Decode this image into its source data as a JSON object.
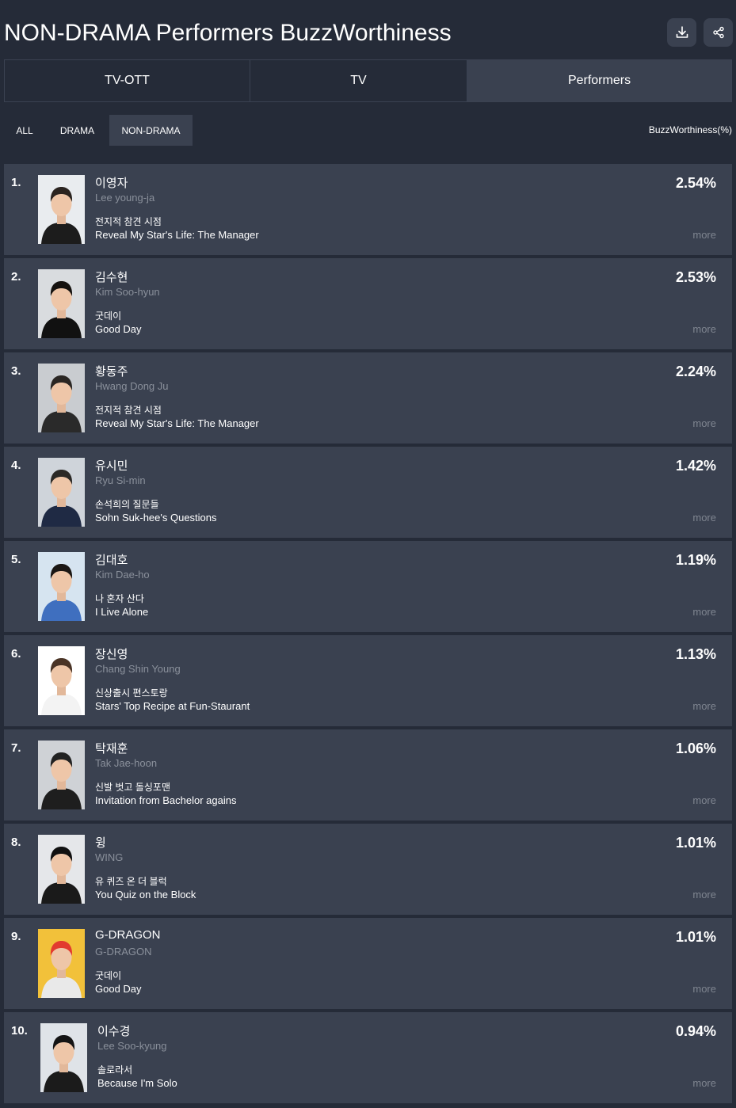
{
  "header": {
    "title": "NON-DRAMA Performers BuzzWorthiness",
    "download_icon": "download-icon",
    "share_icon": "share-icon"
  },
  "main_tabs": [
    {
      "label": "TV-OTT",
      "active": false
    },
    {
      "label": "TV",
      "active": false
    },
    {
      "label": "Performers",
      "active": true
    }
  ],
  "sub_tabs": [
    {
      "label": "ALL",
      "active": false
    },
    {
      "label": "DRAMA",
      "active": false
    },
    {
      "label": "NON-DRAMA",
      "active": true
    }
  ],
  "sort_label": "BuzzWorthiness(%)",
  "more_label": "more",
  "performers": [
    {
      "rank": "1.",
      "name_ko": "이영자",
      "name_en": "Lee young-ja",
      "show_ko": "전지적 참견 시점",
      "show_en": "Reveal My Star's Life: The Manager",
      "pct": "2.54%"
    },
    {
      "rank": "2.",
      "name_ko": "김수현",
      "name_en": "Kim Soo-hyun",
      "show_ko": "굿데이",
      "show_en": "Good Day",
      "pct": "2.53%"
    },
    {
      "rank": "3.",
      "name_ko": "황동주",
      "name_en": "Hwang Dong Ju",
      "show_ko": "전지적 참견 시점",
      "show_en": "Reveal My Star's Life: The Manager",
      "pct": "2.24%"
    },
    {
      "rank": "4.",
      "name_ko": "유시민",
      "name_en": "Ryu Si-min",
      "show_ko": "손석희의 질문들",
      "show_en": "Sohn Suk-hee's Questions",
      "pct": "1.42%"
    },
    {
      "rank": "5.",
      "name_ko": "김대호",
      "name_en": "Kim Dae-ho",
      "show_ko": "나 혼자 산다",
      "show_en": "I Live Alone",
      "pct": "1.19%"
    },
    {
      "rank": "6.",
      "name_ko": "장신영",
      "name_en": "Chang Shin Young",
      "show_ko": "신상출시 편스토랑",
      "show_en": "Stars' Top Recipe at Fun-Staurant",
      "pct": "1.13%"
    },
    {
      "rank": "7.",
      "name_ko": "탁재훈",
      "name_en": "Tak Jae-hoon",
      "show_ko": "신발 벗고 돌싱포맨",
      "show_en": "Invitation from Bachelor agains",
      "pct": "1.06%"
    },
    {
      "rank": "8.",
      "name_ko": "윙",
      "name_en": "WING",
      "show_ko": "유 퀴즈 온 더 블럭",
      "show_en": "You Quiz on the Block",
      "pct": "1.01%"
    },
    {
      "rank": "9.",
      "name_ko": "G-DRAGON",
      "name_en": "G-DRAGON",
      "show_ko": "굿데이",
      "show_en": "Good Day",
      "pct": "1.01%"
    },
    {
      "rank": "10.",
      "name_ko": "이수경",
      "name_en": "Lee Soo-kyung",
      "show_ko": "솔로라서",
      "show_en": "Because I'm Solo",
      "pct": "0.94%"
    }
  ],
  "photo_colors": {
    "bg": [
      "#e9ecef",
      "#d9dcdf",
      "#c9ccd0",
      "#cfd4da",
      "#d6e4f0",
      "#ffffff",
      "#cfd2d6",
      "#e5e7ea",
      "#f2c13a",
      "#dfe3e8"
    ],
    "shirt": [
      "#1c1c1c",
      "#111111",
      "#2a2a2a",
      "#1f2a44",
      "#3f6fbf",
      "#f3f3f3",
      "#1e1e1e",
      "#1a1a1a",
      "#e9e9e9",
      "#1b1b1b"
    ],
    "hair": [
      "#2b2420",
      "#15120f",
      "#2a2623",
      "#2b2926",
      "#1b1714",
      "#4a3426",
      "#222222",
      "#111111",
      "#e23b2f",
      "#141414"
    ]
  }
}
